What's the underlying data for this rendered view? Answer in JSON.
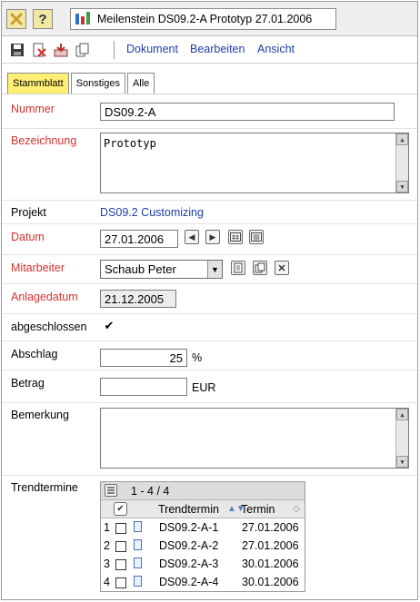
{
  "window": {
    "title": "Meilenstein DS09.2-A Prototyp 27.01.2006",
    "help_label": "?"
  },
  "menu": {
    "items": [
      "Dokument",
      "Bearbeiten",
      "Ansicht"
    ]
  },
  "tabs": [
    "Stammblatt",
    "Sonstiges",
    "Alle"
  ],
  "form": {
    "nummer": {
      "label": "Nummer",
      "value": "DS09.2-A"
    },
    "bezeichnung": {
      "label": "Bezeichnung",
      "value": "Prototyp"
    },
    "projekt": {
      "label": "Projekt",
      "value": "DS09.2 Customizing"
    },
    "datum": {
      "label": "Datum",
      "value": "27.01.2006"
    },
    "mitarbeiter": {
      "label": "Mitarbeiter",
      "value": "Schaub Peter"
    },
    "anlagedatum": {
      "label": "Anlagedatum",
      "value": "21.12.2005"
    },
    "abgeschlossen": {
      "label": "abgeschlossen",
      "checked": true,
      "mark": "✔"
    },
    "abschlag": {
      "label": "Abschlag",
      "value": "25",
      "unit": "%"
    },
    "betrag": {
      "label": "Betrag",
      "value": "",
      "unit": "EUR"
    },
    "bemerkung": {
      "label": "Bemerkung",
      "value": ""
    },
    "trendtermine": {
      "label": "Trendtermine"
    }
  },
  "trend_table": {
    "range": "1 - 4 / 4",
    "columns": [
      "Trendtermin",
      "Termin"
    ],
    "rows": [
      {
        "n": "1",
        "trendtermin": "DS09.2-A-1",
        "termin": "27.01.2006"
      },
      {
        "n": "2",
        "trendtermin": "DS09.2-A-2",
        "termin": "27.01.2006"
      },
      {
        "n": "3",
        "trendtermin": "DS09.2-A-3",
        "termin": "30.01.2006"
      },
      {
        "n": "4",
        "trendtermin": "DS09.2-A-4",
        "termin": "30.01.2006"
      }
    ]
  },
  "colors": {
    "required_label": "#d2322d",
    "link": "#1f3fa8",
    "active_tab": "#ffef74"
  }
}
